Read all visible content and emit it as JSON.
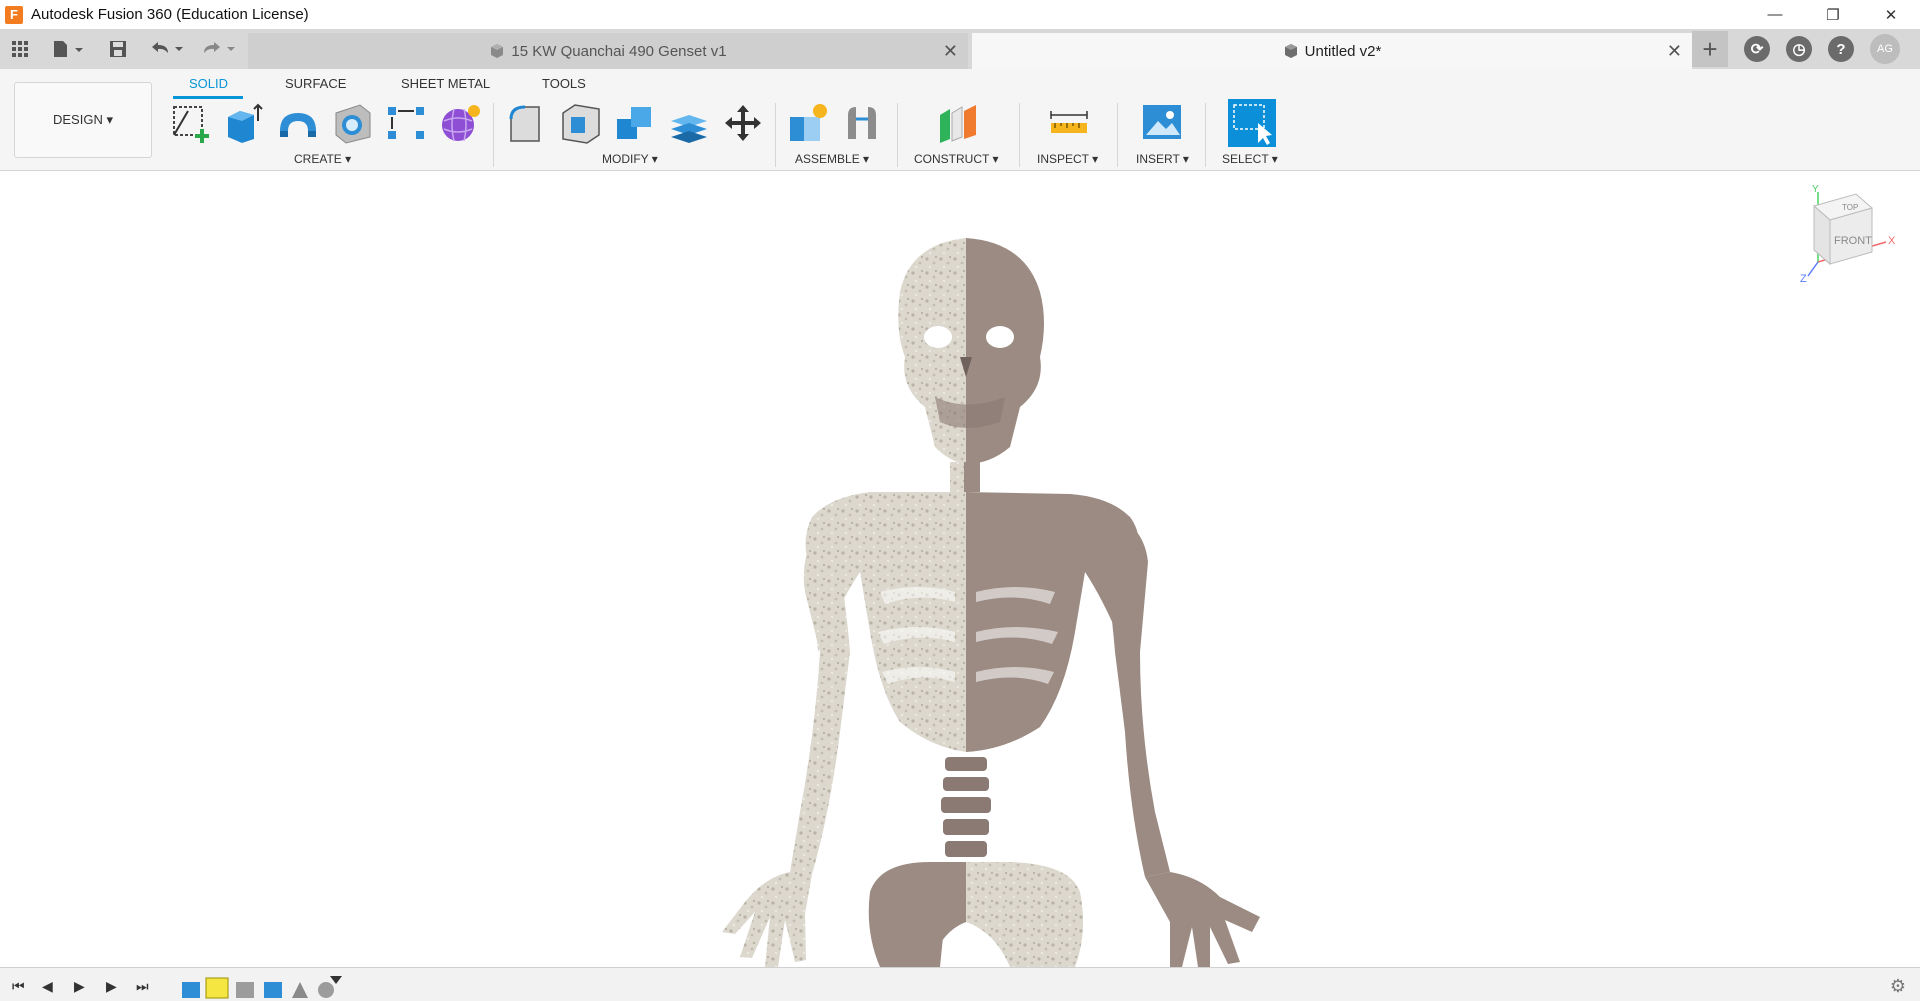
{
  "app": {
    "title": "Autodesk Fusion 360 (Education License)",
    "logo_letter": "F",
    "window_controls": {
      "minimize": "—",
      "restore": "❐",
      "close": "✕"
    }
  },
  "tabs": [
    {
      "label": "15 KW Quanchai 490 Genset v1",
      "close": "✕",
      "active": false
    },
    {
      "label": "Untitled v2*",
      "close": "✕",
      "active": true
    }
  ],
  "header_icons": {
    "new_tab": "+",
    "job_status": "⟳",
    "history": "◷",
    "help": "?",
    "user_initials": "AG"
  },
  "ribbon": {
    "workspace": "DESIGN ▾",
    "tabs": [
      "SOLID",
      "SURFACE",
      "SHEET METAL",
      "TOOLS"
    ],
    "active_tab": "SOLID",
    "groups": {
      "create": "CREATE ▾",
      "modify": "MODIFY ▾",
      "assemble": "ASSEMBLE ▾",
      "construct": "CONSTRUCT ▾",
      "inspect": "INSPECT ▾",
      "insert": "INSERT ▾",
      "select": "SELECT ▾"
    }
  },
  "viewcube": {
    "top": "TOP",
    "front": "FRONT",
    "x_axis": "X",
    "y_axis": "Y",
    "z_axis": "Z"
  },
  "colors": {
    "accent": "#0696d7",
    "bone_textured": "#d9d5cc",
    "bone_solid": "#9c8b83"
  },
  "timeline": {
    "first": "⏮",
    "prev": "◀",
    "play": "▶",
    "next": "▶",
    "last": "⏭",
    "settings": "⚙"
  }
}
